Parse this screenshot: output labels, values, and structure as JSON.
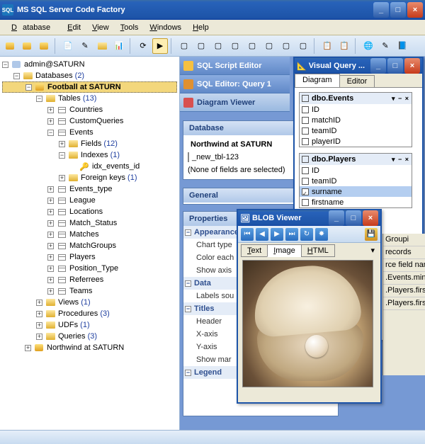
{
  "app_title": "MS SQL Server Code Factory",
  "menu": {
    "database": "Database",
    "edit": "Edit",
    "view": "View",
    "tools": "Tools",
    "windows": "Windows",
    "help": "Help"
  },
  "tree": {
    "root": "admin@SATURN",
    "databases_label": "Databases",
    "databases_count": "(2)",
    "db1": "Football at SATURN",
    "tables_label": "Tables",
    "tables_count": "(13)",
    "t_countries": "Countries",
    "t_custom": "CustomQueries",
    "t_events": "Events",
    "fields_label": "Fields",
    "fields_count": "(12)",
    "indexes_label": "Indexes",
    "indexes_count": "(1)",
    "idx": "idx_events_id",
    "fk_label": "Foreign keys",
    "fk_count": "(1)",
    "t_events_type": "Events_type",
    "t_league": "League",
    "t_locations": "Locations",
    "t_match_status": "Match_Status",
    "t_matches": "Matches",
    "t_matchgroups": "MatchGroups",
    "t_players": "Players",
    "t_position": "Position_Type",
    "t_referrees": "Referrees",
    "t_teams": "Teams",
    "views_label": "Views",
    "views_count": "(1)",
    "procs_label": "Procedures",
    "procs_count": "(3)",
    "udfs_label": "UDFs",
    "udfs_count": "(1)",
    "queries_label": "Queries",
    "queries_count": "(3)",
    "db2": "Northwind at SATURN"
  },
  "tabs": {
    "sql_script": "SQL Script Editor",
    "sql_query": "SQL Editor: Query 1",
    "diagram": "Diagram Viewer"
  },
  "db_panel": {
    "header": "Database",
    "row1": "Northwind at SATURN",
    "row2": "_new_tbl-123",
    "none": "(None of fields are selected)"
  },
  "general_header": "General",
  "props": {
    "header": "Properties",
    "appearance": "Appearance",
    "chart_type": "Chart type",
    "color_each": "Color each",
    "show_axis": "Show axis",
    "data": "Data",
    "labels_source": "Labels sou",
    "titles": "Titles",
    "header_row": "Header",
    "xaxis": "X-axis",
    "yaxis": "Y-axis",
    "show_mar": "Show mar",
    "legend": "Legend"
  },
  "vq": {
    "title": "Visual Query ...",
    "tab_diagram": "Diagram",
    "tab_editor": "Editor",
    "tbl_events": "dbo.Events",
    "f_id": "ID",
    "f_matchid": "matchID",
    "f_teamid": "teamID",
    "f_playerid": "playerID",
    "tbl_players": "dbo.Players",
    "p_id": "ID",
    "p_teamid": "teamID",
    "p_surname": "surname",
    "p_firstname": "firstname"
  },
  "blob": {
    "title": "BLOB Viewer",
    "tab_text": "Text",
    "tab_image": "Image",
    "tab_html": "HTML"
  },
  "side": {
    "groupi": "Groupi",
    "records": "records",
    "rce": "rce field nam",
    "ev_min": ".Events.minu",
    "pl_first": ".Players.first",
    "pl_first2": ".Players.first"
  }
}
